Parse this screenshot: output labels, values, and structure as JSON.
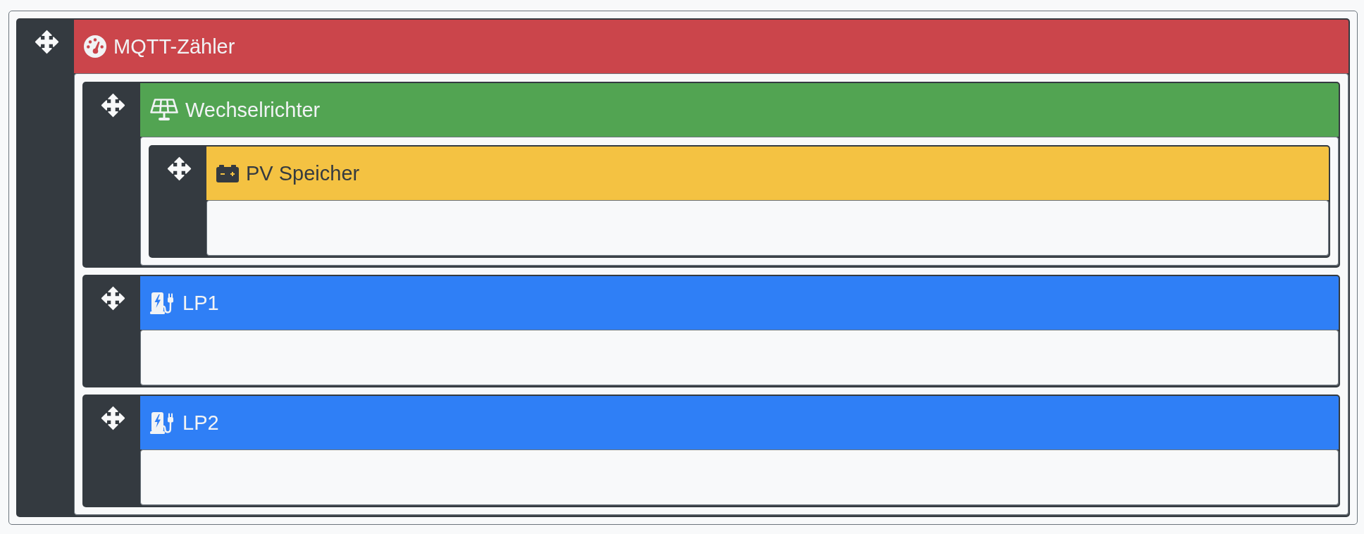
{
  "tree": [
    {
      "title": "MQTT-Zähler",
      "kind": "meter",
      "color": "#cb454b",
      "children": [
        {
          "title": "Wechselrichter",
          "kind": "inverter",
          "color": "#52a452",
          "children": [
            {
              "title": "PV Speicher",
              "kind": "battery",
              "color": "#f4c242"
            }
          ]
        },
        {
          "title": "LP1",
          "kind": "chargepoint",
          "color": "#2f7ff6"
        },
        {
          "title": "LP2",
          "kind": "chargepoint",
          "color": "#2f7ff6"
        }
      ]
    }
  ]
}
